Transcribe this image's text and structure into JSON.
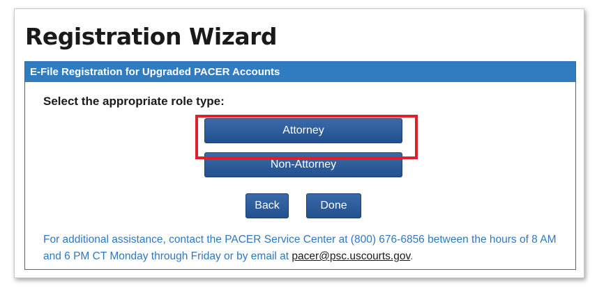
{
  "page": {
    "title": "Registration Wizard"
  },
  "panel": {
    "header": "E-File Registration for Upgraded PACER Accounts",
    "prompt": "Select the appropriate role type:"
  },
  "roles": {
    "attorney_label": "Attorney",
    "non_attorney_label": "Non-Attorney"
  },
  "actions": {
    "back_label": "Back",
    "done_label": "Done"
  },
  "help": {
    "text_before_email": "For additional assistance, contact the PACER Service Center at (800) 676-6856 between the hours of 8 AM and 6 PM CT Monday through Friday or by email at ",
    "email": "pacer@psc.uscourts.gov",
    "text_after_email": "."
  },
  "annotation": {
    "highlighted_element": "Attorney",
    "color": "#e02028"
  },
  "colors": {
    "header_bg": "#2f7cc0",
    "button_bg": "#2b5b9c",
    "help_text": "#2f78c0"
  }
}
